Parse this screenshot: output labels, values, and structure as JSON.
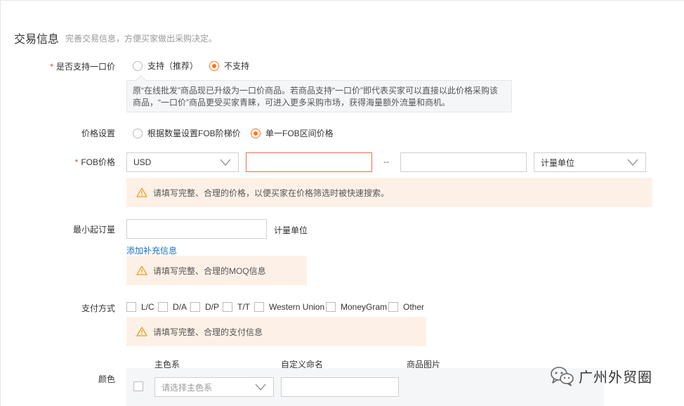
{
  "section": {
    "title": "交易信息",
    "description": "完善交易信息，方便买家做出采购决定。"
  },
  "one_price": {
    "label": "是否支持一口价",
    "required_mark": "*",
    "options": [
      "支持（推荐）",
      "不支持"
    ],
    "selected": "不支持",
    "note": "原“在线批发”商品现已升级为一口价商品。若商品支持“一口价”即代表买家可以直接以此价格采购该商品，“一口价”商品更受买家青睐，可进入更多采购市场，获得海量额外流量和商机。"
  },
  "price_setting": {
    "label": "价格设置",
    "options": [
      "根据数量设置FOB阶梯价",
      "单一FOB区间价格"
    ],
    "selected": "单一FOB区间价格"
  },
  "fob_price": {
    "label": "FOB价格",
    "required_mark": "*",
    "currency": "USD",
    "min_value": "",
    "separator": "--",
    "max_value": "",
    "unit_placeholder": "计量单位",
    "warning": "请填写完整、合理的价格，以便买家在价格筛选时被快速搜索。"
  },
  "moq": {
    "label": "最小起订量",
    "value": "",
    "unit": "计量单位",
    "add_info_link": "添加补充信息",
    "warning": "请填写完整、合理的MOQ信息"
  },
  "payment": {
    "label": "支付方式",
    "options": [
      "L/C",
      "D/A",
      "D/P",
      "T/T",
      "Western Union",
      "MoneyGram",
      "Other"
    ],
    "warning": "请填写完整、合理的支付信息"
  },
  "color": {
    "label": "颜色",
    "headers": [
      "主色系",
      "自定义命名",
      "商品图片"
    ],
    "main_color_placeholder": "请选择主色系",
    "custom_name": ""
  },
  "watermark": {
    "text": "广州外贸圈"
  },
  "colors": {
    "accent": "#ff7519",
    "required": "#e4393c",
    "link": "#1e6fc8",
    "warning_bg": "#fdf1e7",
    "warning_icon": "#f0a020"
  }
}
